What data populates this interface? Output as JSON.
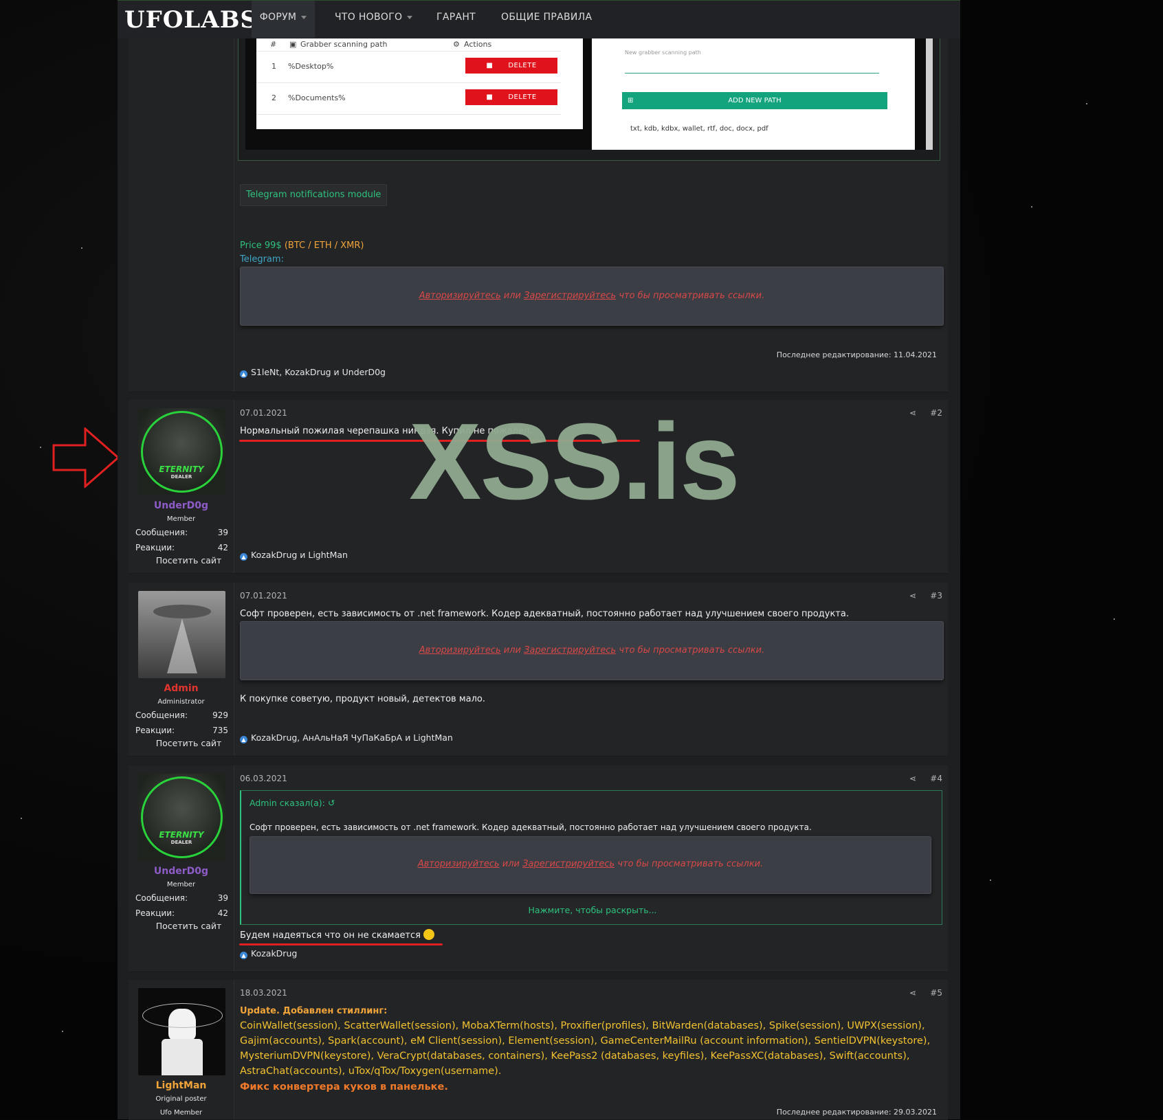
{
  "nav": {
    "logo": "UFOLABS",
    "items": [
      {
        "label": "ФОРУМ",
        "has_caret": true,
        "active": true
      },
      {
        "label": "ЧТО НОВОГО",
        "has_caret": true,
        "active": false
      },
      {
        "label": "ГАРАНТ",
        "has_caret": false,
        "active": false
      },
      {
        "label": "ОБЩИЕ ПРАВИЛА",
        "has_caret": false,
        "active": false
      }
    ]
  },
  "screenshot": {
    "table_headers": [
      "#",
      "Grabber scanning path",
      "Actions"
    ],
    "rows": [
      {
        "idx": "1",
        "path": "%Desktop%",
        "action": "DELETE"
      },
      {
        "idx": "2",
        "path": "%Documents%",
        "action": "DELETE"
      }
    ],
    "form_placeholder": "New grabber scanning path",
    "add_button": "ADD NEW PATH",
    "extensions": "txt, kdb, kdbx, wallet, rtf, doc, docx, pdf"
  },
  "post1": {
    "telegram_button": "Telegram notifications module",
    "price_label": "Price 99$",
    "price_currencies": "(BTC / ETH / XMR)",
    "telegram_label": "Telegram:",
    "locked_login": "Авторизируйтесь",
    "locked_or": "или",
    "locked_register": "Зарегистрируйтесь",
    "locked_rest": "что бы просматривать ссылки.",
    "edited": "Последнее редактирование: 11.04.2021",
    "reactions": "S1leNt, KozakDrug и UnderD0g"
  },
  "users": {
    "underdog": {
      "name": "UnderD0g",
      "title": "Member",
      "messages_label": "Сообщения:",
      "messages": "39",
      "reactions_label": "Реакции:",
      "reactions": "42",
      "visit": "Посетить сайт",
      "avatar_text": "ETERNITY",
      "avatar_sub": "DEALER"
    },
    "admin": {
      "name": "Admin",
      "title": "Administrator",
      "messages_label": "Сообщения:",
      "messages": "929",
      "reactions_label": "Реакции:",
      "reactions": "735",
      "visit": "Посетить сайт"
    },
    "lightman": {
      "name": "LightMan",
      "title": "Original poster",
      "title2": "Ufo Member"
    }
  },
  "post2": {
    "date": "07.01.2021",
    "num": "#2",
    "text": "Нормальный пожилая черепашка ниндзя. Купил не пожалел.",
    "reactions": "KozakDrug и LightMan"
  },
  "post3": {
    "date": "07.01.2021",
    "num": "#3",
    "text": "Софт проверен, есть зависимость от .net framework. Кодер адекватный, постоянно работает над улучшением своего продукта.",
    "text2": "К покупке советую, продукт новый, детектов мало.",
    "reactions": "KozakDrug, АнАльНаЯ ЧуПаКаБрА и LightMan"
  },
  "post4": {
    "date": "06.03.2021",
    "num": "#4",
    "quote_author": "Admin сказал(а):",
    "quote_text": "Софт проверен, есть зависимость от .net framework. Кодер адекватный, постоянно работает над улучшением своего продукта.",
    "expand": "Нажмите, чтобы раскрыть...",
    "text": "Будем надеяться что он не скамается",
    "reactions": "KozakDrug"
  },
  "post5": {
    "date": "18.03.2021",
    "num": "#5",
    "update_heading": "Update. Добавлен стиллинг:",
    "line1": "CoinWallet(session), ScatterWallet(session), MobaXTerm(hosts), Proxifier(profiles), BitWarden(databases), Spike(session), UWPX(session),",
    "line2": "Gajim(accounts), Spark(account), eM Client(session), Element(session), GameCenterMailRu (account information), SentielDVPN(keystore),",
    "line3": "MysteriumDVPN(keystore), VeraCrypt(databases, containers), KeePass2 (databases, keyfiles), KeePassXC(databases), Swift(accounts),",
    "line4": "AstraChat(accounts), uTox/qTox/Toxygen(username).",
    "fix": "Фикс конвертера куков в панельке.",
    "edited": "Последнее редактирование: 29.03.2021"
  },
  "watermark": "XSS.is",
  "colors": {
    "accent_green": "#2ec27e",
    "member_purple": "#8e5cc8",
    "admin_red": "#e0352f",
    "orange": "#f0a43a",
    "locked_red": "#d94848"
  }
}
